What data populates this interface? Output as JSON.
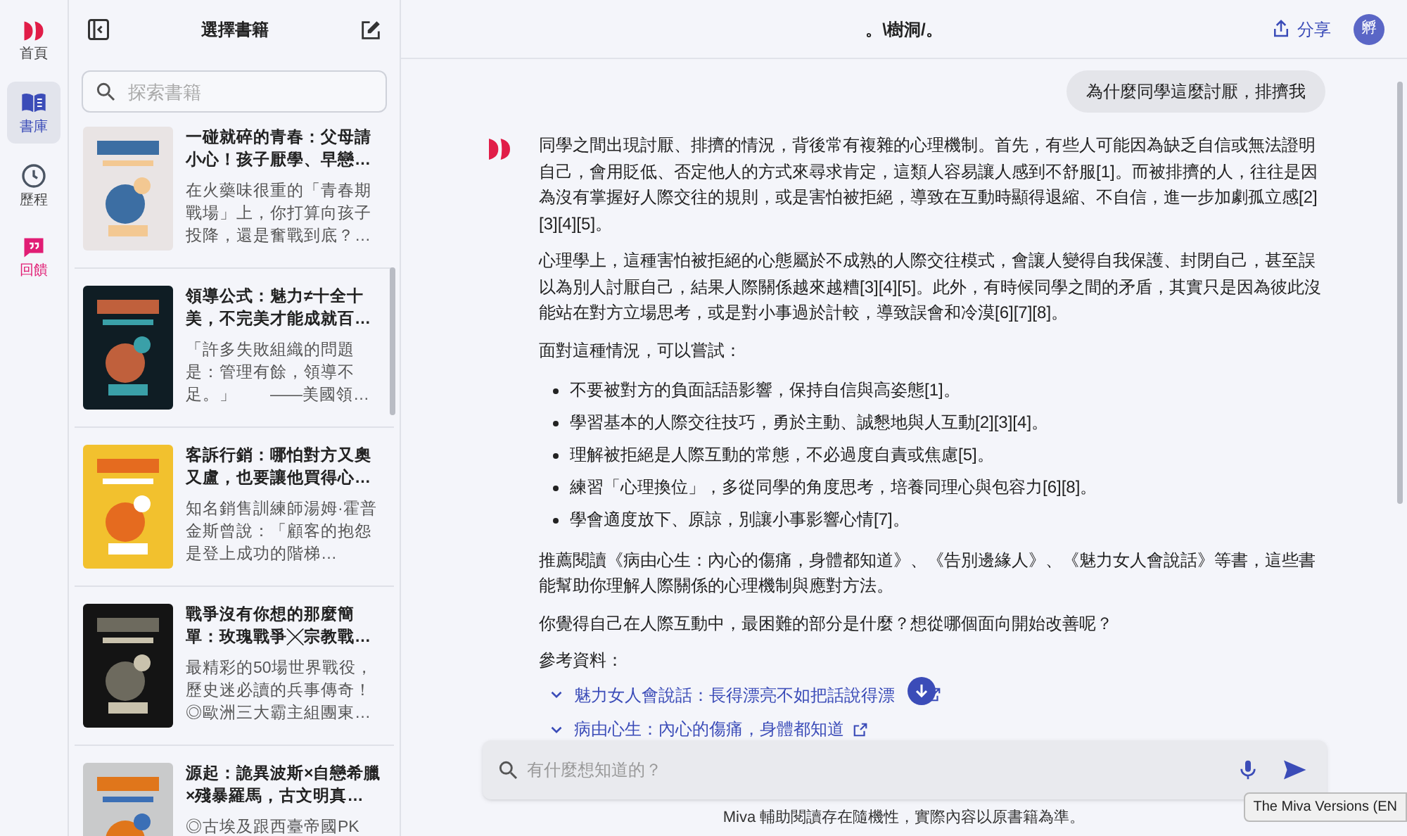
{
  "nav": [
    {
      "label": "首頁",
      "kind": "logo",
      "selected": false,
      "color": "#e11d48"
    },
    {
      "label": "書庫",
      "kind": "book",
      "selected": true,
      "color": "#3b4cb8"
    },
    {
      "label": "歷程",
      "kind": "clock",
      "selected": false,
      "color": "#4b5563"
    },
    {
      "label": "回饋",
      "kind": "quote",
      "selected": false,
      "color": "#e11d74"
    }
  ],
  "sidebar": {
    "title": "選擇書籍",
    "search": {
      "placeholder": "探索書籍"
    },
    "books": [
      {
        "title": "一碰就碎的青春：父母請小心！孩子厭學、早戀…",
        "description": "在火藥味很重的「青春期戰場」上，你打算向孩子投降，還是奮戰到底？…"
      },
      {
        "title": "領導公式：魅力≠十全十美，不完美才能成就百…",
        "description": "「許多失敗組織的問題是：管理有餘，領導不足。」　　——美國領…"
      },
      {
        "title": "客訴行銷：哪怕對方又奧又盧，也要讓他買得心…",
        "description": "知名銷售訓練師湯姆·霍普金斯曾說：「顧客的抱怨是登上成功的階梯…"
      },
      {
        "title": "戰爭沒有你想的那麼簡單：玫瑰戰爭╳宗教戰…",
        "description": "最精彩的50場世界戰役，歷史迷必讀的兵事傳奇！◎歐洲三大霸主組團東…"
      },
      {
        "title": "源起：詭異波斯×自戀希臘×殘暴羅馬，古文明真…",
        "description": "◎古埃及跟西臺帝國PK"
      }
    ]
  },
  "header": {
    "title": "。\\樹洞/。",
    "share": "分享",
    "avatar": "孵"
  },
  "chat": {
    "question": "為什麼同學這麼討厭，排擠我",
    "answer": [
      {
        "kind": "paragraph",
        "text": "同學之間出現討厭、排擠的情況，背後常有複雜的心理機制。首先，有些人可能因為缺乏自信或無法證明自己，會用貶低、否定他人的方式來尋求肯定，這類人容易讓人感到不舒服[1]。而被排擠的人，往往是因為沒有掌握好人際交往的規則，或是害怕被拒絕，導致在互動時顯得退縮、不自信，進一步加劇孤立感[2][3][4][5]。"
      },
      {
        "kind": "paragraph",
        "text": "心理學上，這種害怕被拒絕的心態屬於不成熟的人際交往模式，會讓人變得自我保護、封閉自己，甚至誤以為別人討厭自己，結果人際關係越來越糟[3][4][5]。此外，有時候同學之間的矛盾，其實只是因為彼此沒能站在對方立場思考，或是對小事過於計較，導致誤會和冷漠[6][7][8]。"
      },
      {
        "kind": "paragraph",
        "text": "面對這種情況，可以嘗試："
      },
      {
        "kind": "list",
        "items": [
          "不要被對方的負面話語影響，保持自信與高姿態[1]。",
          "學習基本的人際交往技巧，勇於主動、誠懇地與人互動[2][3][4]。",
          "理解被拒絕是人際互動的常態，不必過度自責或焦慮[5]。",
          "練習「心理換位」，多從同學的角度思考，培養同理心與包容力[6][8]。",
          "學會適度放下、原諒，別讓小事影響心情[7]。"
        ]
      },
      {
        "kind": "paragraph",
        "text": "推薦閱讀《病由心生：內心的傷痛，身體都知道》、《告別邊緣人》、《魅力女人會說話》等書，這些書能幫助你理解人際關係的心理機制與應對方法。"
      },
      {
        "kind": "paragraph",
        "text": "你覺得自己在人際互動中，最困難的部分是什麼？想從哪個面向開始改善呢？"
      },
      {
        "kind": "paragraph",
        "text": "參考資料："
      }
    ],
    "references": [
      "魅力女人會說話：長得漂亮不如把話說得漂",
      "病由心生：內心的傷痛，身體都知道"
    ]
  },
  "input": {
    "placeholder": "有什麼想知道的？"
  },
  "disclaimer": "Miva 輔助閱讀存在隨機性，實際內容以原書籍為準。",
  "tooltip": "The Miva Versions (EN"
}
